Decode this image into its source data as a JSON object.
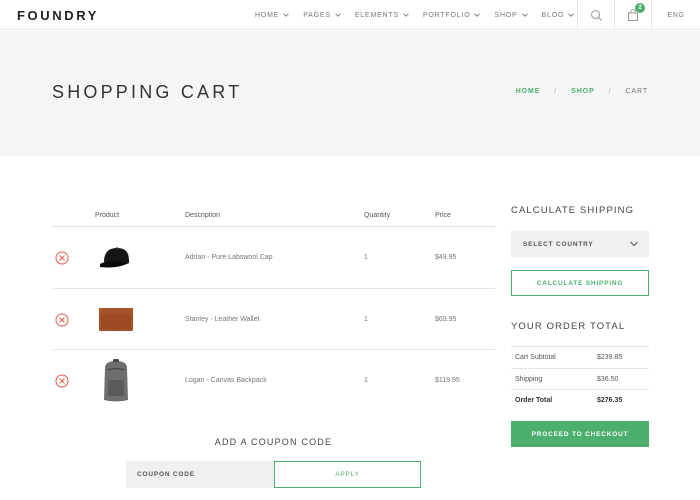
{
  "header": {
    "logo": "FOUNDRY",
    "nav": [
      {
        "label": "HOME"
      },
      {
        "label": "PAGES"
      },
      {
        "label": "ELEMENTS"
      },
      {
        "label": "PORTFOLIO"
      },
      {
        "label": "SHOP"
      },
      {
        "label": "BLOG"
      }
    ],
    "cart_count": "2",
    "language": "ENG",
    "icons": {
      "search": "search-icon",
      "cart": "shopping-bag-icon"
    }
  },
  "title_band": {
    "title": "SHOPPING CART",
    "breadcrumb": {
      "home": "HOME",
      "shop": "SHOP",
      "current": "CART",
      "separator": "/"
    }
  },
  "cart": {
    "headers": {
      "product": "Product",
      "description": "Description",
      "quantity": "Quantity",
      "price": "Price"
    },
    "rows": [
      {
        "image": "cap-image",
        "description": "Adrian - Pure Labswool Cap",
        "quantity": "1",
        "price": "$49.95"
      },
      {
        "image": "wallet-image",
        "description": "Stanley - Leather Wallet",
        "quantity": "1",
        "price": "$69.95"
      },
      {
        "image": "backpack-image",
        "description": "Logan - Canvas Backpack",
        "quantity": "1",
        "price": "$119.95"
      }
    ]
  },
  "shipping": {
    "heading": "CALCULATE SHIPPING",
    "select_value": "SELECT COUNTRY",
    "button": "CALCULATE SHIPPING"
  },
  "order_total": {
    "heading": "YOUR ORDER TOTAL",
    "rows": [
      {
        "label": "Cart Subtotal",
        "value": "$239.85"
      },
      {
        "label": "Shipping",
        "value": "$36.50"
      },
      {
        "label": "Order Total",
        "value": "$276.35"
      }
    ],
    "checkout_button": "PROCEED TO CHECKOUT"
  },
  "coupon": {
    "heading": "ADD A COUPON CODE",
    "placeholder": "COUPON CODE",
    "button": "APPLY"
  },
  "colors": {
    "accent": "#4caf6e",
    "remove": "#e05a4e",
    "band": "#f5f5f5"
  }
}
